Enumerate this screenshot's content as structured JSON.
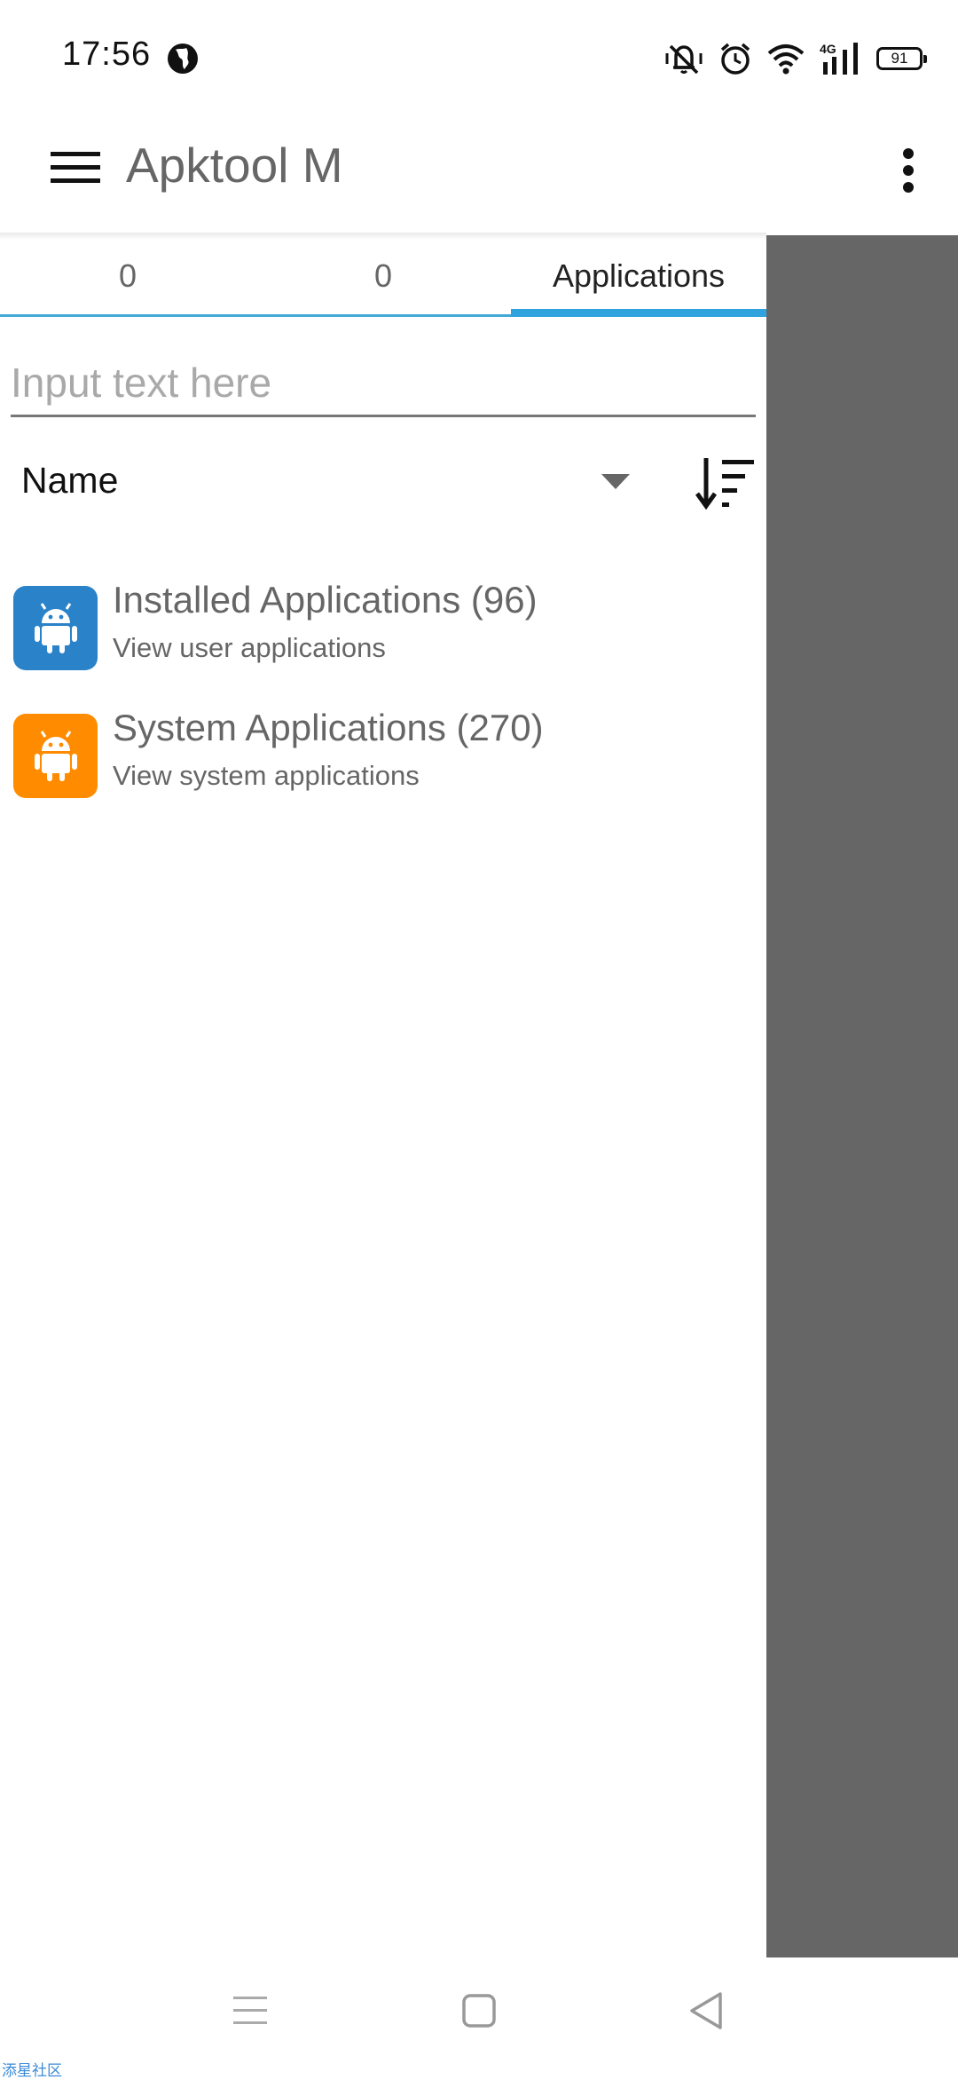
{
  "status_bar": {
    "time": "17:56",
    "network": "4G",
    "battery": "91",
    "icons": [
      "globe-icon",
      "vibrate-icon",
      "alarm-icon",
      "wifi-icon",
      "signal-icon",
      "battery-icon"
    ]
  },
  "app_bar": {
    "title": "Apktool M",
    "icons": [
      "menu-icon",
      "more-vert-icon"
    ]
  },
  "tabs": [
    {
      "label": "0"
    },
    {
      "label": "0"
    },
    {
      "label": "Applications",
      "active": true
    }
  ],
  "search": {
    "placeholder": "Input text here",
    "value": ""
  },
  "sort": {
    "selected": "Name",
    "icons": [
      "dropdown-caret-icon",
      "sort-order-icon"
    ]
  },
  "list": {
    "items": [
      {
        "title": "Installed Applications (96)",
        "subtitle": "View user applications",
        "icon": "android-icon",
        "color": "#2a82c9"
      },
      {
        "title": "System Applications (270)",
        "subtitle": "View system applications",
        "icon": "android-icon",
        "color": "#ff8c00"
      }
    ]
  },
  "colors": {
    "accent": "#2fa3de",
    "scrim": "#666666",
    "installed_icon_bg": "#2a82c9",
    "system_icon_bg": "#ff8c00"
  },
  "nav_bar": {
    "icons": [
      "recents-icon",
      "home-icon",
      "back-icon"
    ]
  },
  "watermark": "添星社区"
}
